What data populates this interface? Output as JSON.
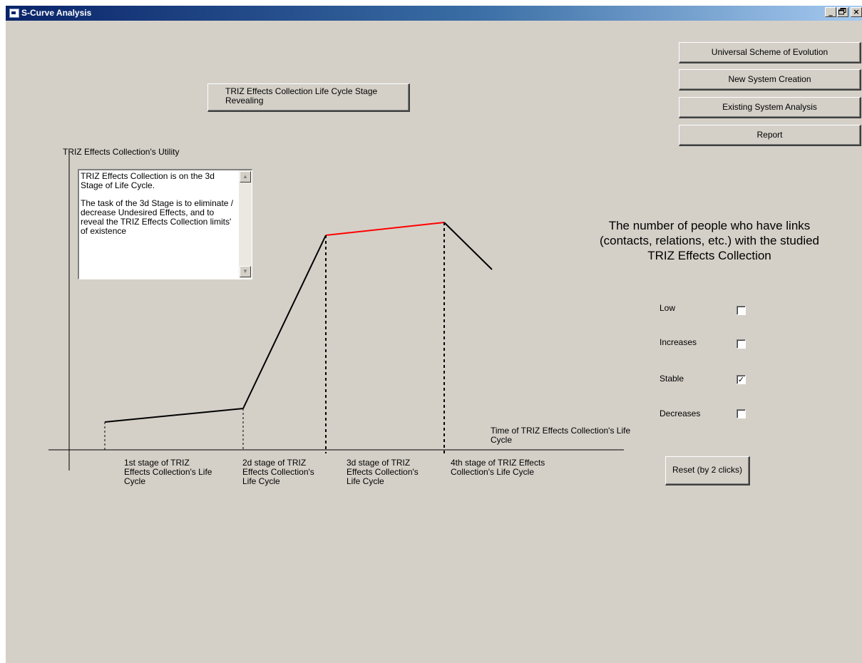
{
  "window": {
    "title": "S-Curve Analysis",
    "controls": {
      "minimize": "_",
      "maximize": "🗗",
      "close": "×"
    }
  },
  "buttons": {
    "reveal_stage": "TRIZ Effects Collection Life Cycle Stage Revealing",
    "universal_scheme": "Universal Scheme of Evolution",
    "new_system": "New System Creation",
    "existing_system": "Existing System Analysis",
    "report": "Report",
    "reset": "Reset (by 2 clicks)"
  },
  "chart": {
    "y_axis_label": "TRIZ Effects Collection's Utility",
    "x_axis_label": "Time of TRIZ Effects Collection's Life Cycle",
    "stages": [
      "1st stage of TRIZ Effects Collection's Life Cycle",
      "2d stage of TRIZ Effects Collection's Life Cycle",
      "3d stage of TRIZ Effects Collection's Life Cycle",
      "4th stage of TRIZ Effects Collection's Life Cycle"
    ],
    "highlight_color": "#ff0000",
    "line_color": "#000000"
  },
  "description": {
    "paragraph1": "TRIZ Effects Collection is on the 3d Stage of Life Cycle.",
    "paragraph2": "The task of the 3d Stage is to eliminate / decrease Undesired Effects, and to reveal the TRIZ Effects Collection limits' of existence"
  },
  "people_links": {
    "heading": "The number of people who have links (contacts, relations, etc.) with the studied TRIZ Effects Collection",
    "options": [
      {
        "label": "Low",
        "checked": false
      },
      {
        "label": "Increases",
        "checked": false
      },
      {
        "label": "Stable",
        "checked": true
      },
      {
        "label": "Decreases",
        "checked": false
      }
    ]
  }
}
